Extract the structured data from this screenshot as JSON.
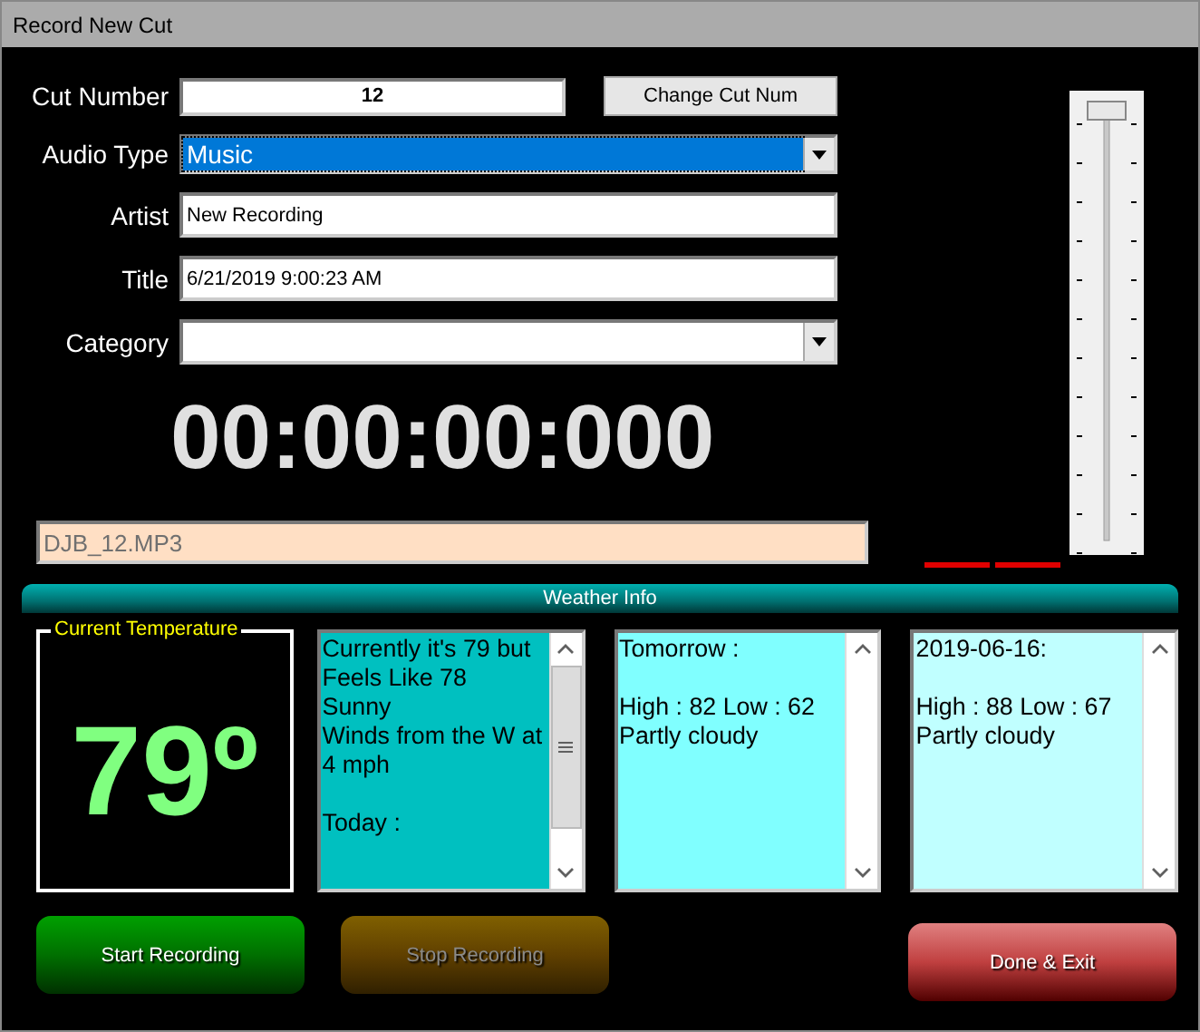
{
  "window": {
    "title": "Record New Cut"
  },
  "form": {
    "cut_number": {
      "label": "Cut Number",
      "value": "12",
      "button": "Change Cut Num"
    },
    "audio_type": {
      "label": "Audio Type",
      "value": "Music"
    },
    "artist": {
      "label": "Artist",
      "value": "New Recording"
    },
    "title": {
      "label": "Title",
      "value": "6/21/2019 9:00:23 AM"
    },
    "category": {
      "label": "Category"
    }
  },
  "timer": "00:00:00:000",
  "filename": "DJB_12.MP3",
  "volume": {
    "level": 1.0
  },
  "weather": {
    "header": "Weather Info",
    "current_temperature": {
      "label": "Current Temperature",
      "value": "79º"
    },
    "panels": [
      {
        "text": "Currently it's 79 but Feels Like 78\nSunny\nWinds from the W at 4 mph\n\nToday :",
        "color": "#00c0c0"
      },
      {
        "text": "Tomorrow :\n\nHigh : 82 Low : 62\nPartly cloudy",
        "color": "#80ffff"
      },
      {
        "text": "2019-06-16:\n\nHigh : 88 Low : 67\nPartly cloudy",
        "color": "#c0ffff"
      }
    ]
  },
  "buttons": [
    {
      "label": "Start Recording",
      "kind": "start",
      "disabled": false
    },
    {
      "label": "Stop Recording",
      "kind": "stop",
      "disabled": true
    },
    {
      "label": "Done & Exit",
      "kind": "exit",
      "disabled": false
    }
  ]
}
